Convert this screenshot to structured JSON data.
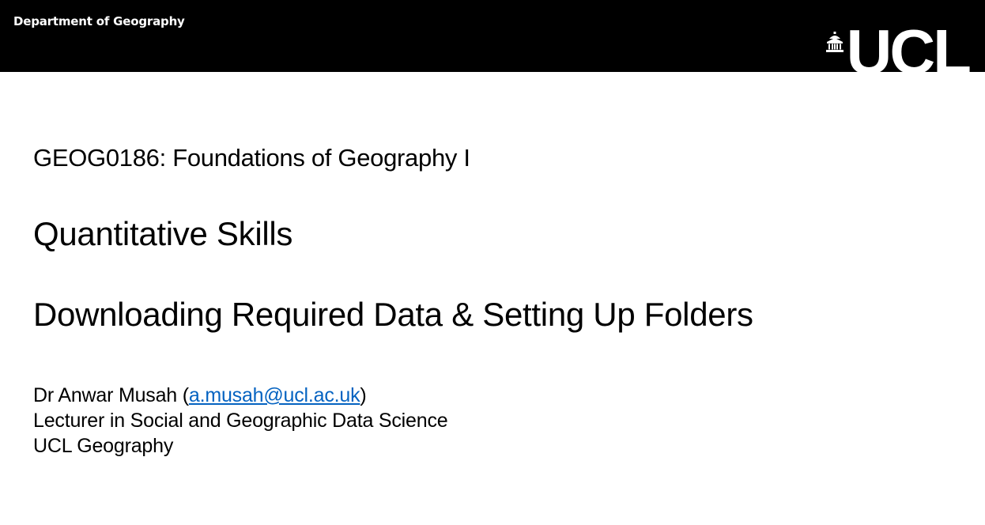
{
  "header": {
    "department": "Department of Geography",
    "logo_text": "UCL",
    "logo_icon": "portico-icon"
  },
  "title": {
    "course": "GEOG0186: Foundations of Geography I",
    "subject": "Quantitative Skills",
    "topic": "Downloading Required Data & Setting Up Folders"
  },
  "author": {
    "name_prefix": "Dr Anwar Musah (",
    "email": "a.musah@ucl.ac.uk",
    "name_suffix": ")",
    "role": "Lecturer in Social and Geographic Data Science",
    "affiliation": "UCL Geography"
  },
  "colors": {
    "banner": "#000000",
    "link": "#0563c1",
    "text": "#000000"
  }
}
